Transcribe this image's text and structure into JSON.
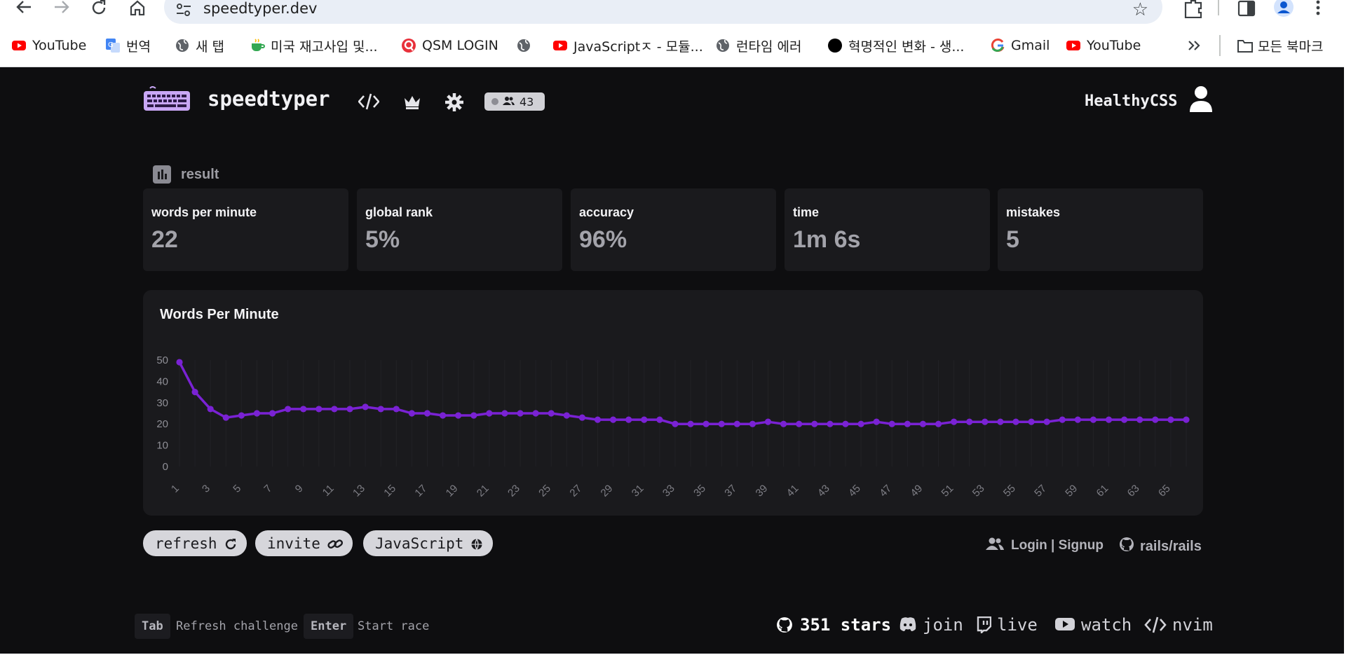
{
  "browser": {
    "url": "speedtyper.dev",
    "bookmarks": [
      {
        "label": "YouTube",
        "icon": "youtube-icon"
      },
      {
        "label": "번역",
        "icon": "translate-icon"
      },
      {
        "label": "새 탭",
        "icon": "globe-icon"
      },
      {
        "label": "미국 재고사입 및...",
        "icon": "cup-icon"
      },
      {
        "label": "QSM LOGIN",
        "icon": "q-logo-icon"
      },
      {
        "label": "",
        "icon": "globe-icon"
      },
      {
        "label": "JavaScriptㅈ - 모듈...",
        "icon": "youtube-icon"
      },
      {
        "label": "런타임 에러",
        "icon": "globe-icon"
      },
      {
        "label": "혁명적인 변화 - 생...",
        "icon": "circle-icon"
      },
      {
        "label": "Gmail",
        "icon": "google-icon"
      },
      {
        "label": "YouTube",
        "icon": "youtube-icon"
      }
    ],
    "all_bookmarks": "모든 북마크",
    "colors": {
      "youtube": "#ff0000",
      "accent": "#0b57d0"
    }
  },
  "header": {
    "brand": "speedtyper",
    "online_count": "43",
    "username": "HealthyCSS"
  },
  "result": {
    "label": "result",
    "stats": [
      {
        "label": "words per minute",
        "value": "22"
      },
      {
        "label": "global rank",
        "value": "5%"
      },
      {
        "label": "accuracy",
        "value": "96%"
      },
      {
        "label": "time",
        "value": "1m 6s"
      },
      {
        "label": "mistakes",
        "value": "5"
      }
    ]
  },
  "chart_data": {
    "type": "line",
    "title": "Words Per Minute",
    "xlabel": "",
    "ylabel": "",
    "ylim": [
      0,
      50
    ],
    "yticks": [
      "0",
      "10",
      "20",
      "30",
      "40",
      "50"
    ],
    "xticks": [
      "1",
      "3",
      "5",
      "7",
      "9",
      "11",
      "13",
      "15",
      "17",
      "19",
      "21",
      "23",
      "25",
      "27",
      "29",
      "31",
      "33",
      "35",
      "37",
      "39",
      "41",
      "43",
      "45",
      "47",
      "49",
      "51",
      "53",
      "55",
      "57",
      "59",
      "61",
      "63",
      "65"
    ],
    "x": [
      1,
      2,
      3,
      4,
      5,
      6,
      7,
      8,
      9,
      10,
      11,
      12,
      13,
      14,
      15,
      16,
      17,
      18,
      19,
      20,
      21,
      22,
      23,
      24,
      25,
      26,
      27,
      28,
      29,
      30,
      31,
      32,
      33,
      34,
      35,
      36,
      37,
      38,
      39,
      40,
      41,
      42,
      43,
      44,
      45,
      46,
      47,
      48,
      49,
      50,
      51,
      52,
      53,
      54,
      55,
      56,
      57,
      58,
      59,
      60,
      61,
      62,
      63,
      64,
      65,
      66
    ],
    "series": [
      {
        "values": [
          49,
          35,
          27,
          23,
          24,
          25,
          25,
          27,
          27,
          27,
          27,
          27,
          28,
          27,
          27,
          25,
          25,
          24,
          24,
          24,
          25,
          25,
          25,
          25,
          25,
          24,
          23,
          22,
          22,
          22,
          22,
          22,
          20,
          20,
          20,
          20,
          20,
          20,
          21,
          20,
          20,
          20,
          20,
          20,
          20,
          21,
          20,
          20,
          20,
          20,
          21,
          21,
          21,
          21,
          21,
          21,
          21,
          22,
          22,
          22,
          22,
          22,
          22,
          22,
          22,
          22
        ]
      }
    ],
    "line_color": "#7a22d4",
    "grid": true
  },
  "actions": {
    "refresh": "refresh",
    "invite": "invite",
    "language": "JavaScript",
    "login": "Login | Signup",
    "repo": "rails/rails"
  },
  "footer": {
    "tab_key": "Tab",
    "tab_desc": "Refresh challenge",
    "enter_key": "Enter",
    "enter_desc": "Start race",
    "stars": "351 stars",
    "join": "join",
    "live": "live",
    "watch": "watch",
    "nvim": "nvim"
  }
}
